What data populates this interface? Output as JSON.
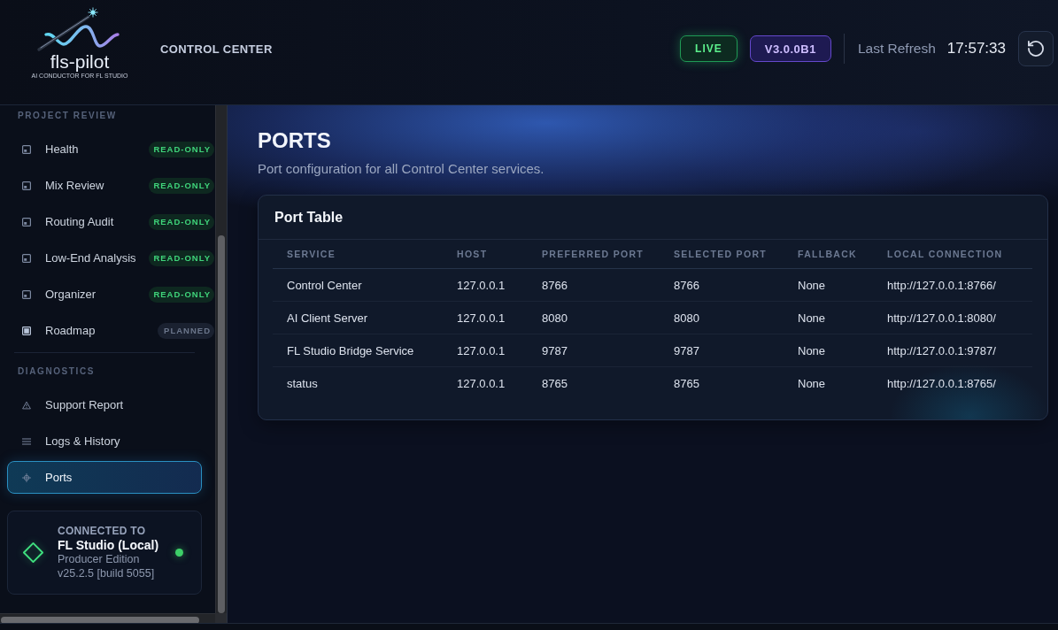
{
  "header": {
    "brand": {
      "name": "fls-pilot",
      "tagline": "AI CONDUCTOR FOR FL STUDIO"
    },
    "title": "CONTROL CENTER",
    "badges": [
      {
        "text": "LIVE",
        "kind": "live"
      },
      {
        "text": "V3.0.0B1",
        "kind": "version"
      }
    ],
    "refresh_label": "Last Refresh",
    "refresh_time": "17:57:33"
  },
  "sidebar": {
    "sections": [
      {
        "title": "PROJECT REVIEW",
        "items": [
          {
            "label": "Health",
            "kind": "review",
            "selected": false,
            "badge": {
              "text": "READ-ONLY",
              "kind": "readonly"
            }
          },
          {
            "label": "Mix Review",
            "kind": "review",
            "selected": false,
            "badge": {
              "text": "READ-ONLY",
              "kind": "readonly"
            }
          },
          {
            "label": "Routing Audit",
            "kind": "review",
            "selected": false,
            "badge": {
              "text": "READ-ONLY",
              "kind": "readonly"
            }
          },
          {
            "label": "Low-End Analysis",
            "kind": "review",
            "selected": false,
            "badge": {
              "text": "READ-ONLY",
              "kind": "readonly"
            }
          },
          {
            "label": "Organizer",
            "kind": "review",
            "selected": false,
            "badge": {
              "text": "READ-ONLY",
              "kind": "readonly"
            }
          },
          {
            "label": "Roadmap",
            "kind": "planned",
            "selected": false,
            "badge": {
              "text": "PLANNED",
              "kind": "planned"
            }
          }
        ]
      },
      {
        "title": "DIAGNOSTICS",
        "items": [
          {
            "label": "Support Report",
            "kind": "report",
            "selected": false
          },
          {
            "label": "Logs & History",
            "kind": "logs",
            "selected": false
          },
          {
            "label": "Ports",
            "kind": "ports",
            "selected": true
          }
        ]
      }
    ],
    "connection": {
      "heading": "CONNECTED TO",
      "name": "FL Studio (Local)",
      "edition": "Producer Edition",
      "version": "v25.2.5 [build 5055]",
      "online": true
    }
  },
  "page": {
    "title": "PORTS",
    "subtitle": "Port configuration for all Control Center services.",
    "card": {
      "title": "Port Table",
      "columns": [
        "SERVICE",
        "HOST",
        "PREFERRED PORT",
        "SELECTED PORT",
        "FALLBACK",
        "LOCAL CONNECTION"
      ],
      "rows": [
        [
          "Control Center",
          "127.0.0.1",
          "8766",
          "8766",
          "None",
          "http://127.0.0.1:8766/"
        ],
        [
          "AI Client Server",
          "127.0.0.1",
          "8080",
          "8080",
          "None",
          "http://127.0.0.1:8080/"
        ],
        [
          "FL Studio Bridge Service",
          "127.0.0.1",
          "9787",
          "9787",
          "None",
          "http://127.0.0.1:9787/"
        ],
        [
          "status",
          "127.0.0.1",
          "8765",
          "8765",
          "None",
          "http://127.0.0.1:8765/"
        ]
      ]
    }
  }
}
